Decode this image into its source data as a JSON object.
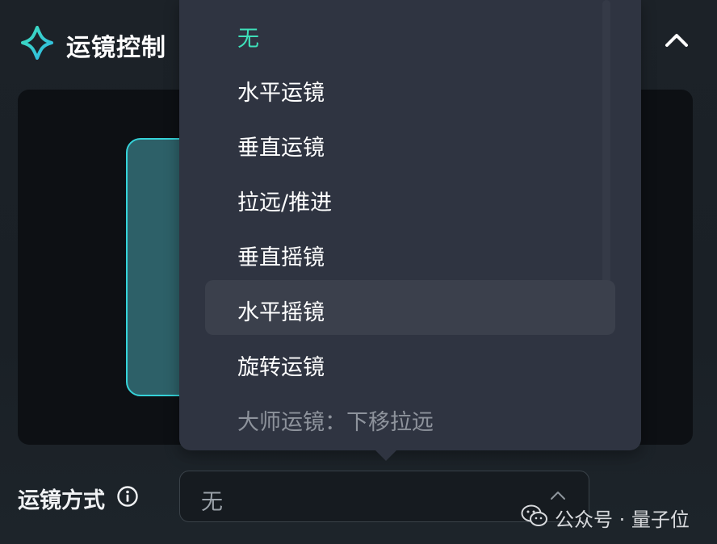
{
  "header": {
    "title": "运镜控制",
    "logo_icon": "sparkle-logo-icon",
    "collapse_icon": "chevron-up-icon"
  },
  "colors": {
    "accent": "#3ee0b9",
    "frame_border": "#35d2d8",
    "frame_fill": "#2d6068",
    "dropdown_bg": "#2f3441"
  },
  "mode": {
    "label": "运镜方式",
    "info_icon": "info-circle-icon",
    "select_value": "无",
    "caret_icon": "chevron-up-icon"
  },
  "dropdown": {
    "options": [
      {
        "label": "无",
        "state": "selected"
      },
      {
        "label": "水平运镜",
        "state": "normal"
      },
      {
        "label": "垂直运镜",
        "state": "normal"
      },
      {
        "label": "拉远/推进",
        "state": "normal"
      },
      {
        "label": "垂直摇镜",
        "state": "normal"
      },
      {
        "label": "水平摇镜",
        "state": "hover"
      },
      {
        "label": "旋转运镜",
        "state": "normal"
      },
      {
        "label": "大师运镜：下移拉远",
        "state": "muted"
      }
    ]
  },
  "watermark": {
    "icon": "wechat-icon",
    "text": "公众号 · 量子位"
  }
}
